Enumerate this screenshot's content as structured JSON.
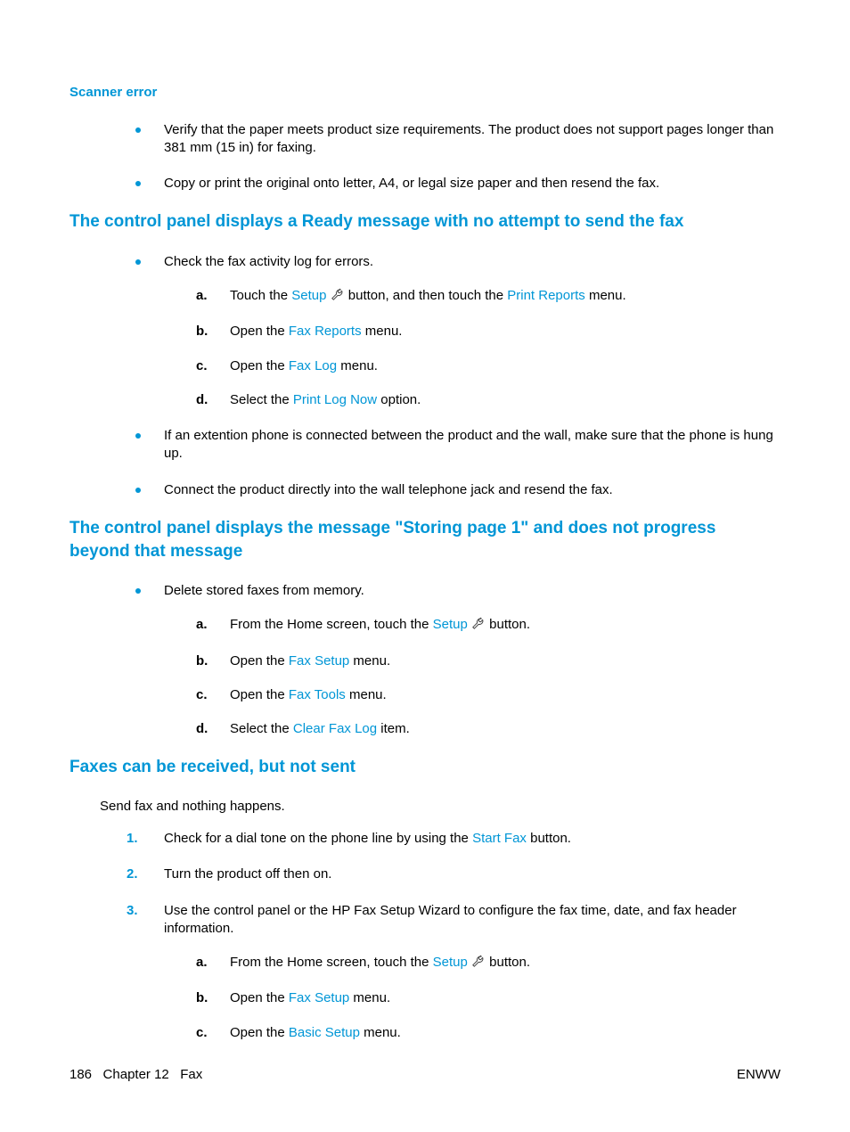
{
  "section_scanner_error": {
    "title": "Scanner error",
    "bullets": [
      "Verify that the paper meets product size requirements. The product does not support pages longer than 381 mm (15 in) for faxing.",
      "Copy or print the original onto letter, A4, or legal size paper and then resend the fax."
    ]
  },
  "section_ready": {
    "title": "The control panel displays a Ready message with no attempt to send the fax",
    "bullet1": "Check the fax activity log for errors.",
    "steps": {
      "a_pre": "Touch the ",
      "a_link1": "Setup",
      "a_mid": " button, and then touch the ",
      "a_link2": "Print Reports",
      "a_post": " menu.",
      "b_pre": "Open the ",
      "b_link": "Fax Reports",
      "b_post": " menu.",
      "c_pre": "Open the ",
      "c_link": "Fax Log",
      "c_post": " menu.",
      "d_pre": "Select the ",
      "d_link": "Print Log Now",
      "d_post": " option."
    },
    "bullet2": "If an extention phone is connected between the product and the wall, make sure that the phone is hung up.",
    "bullet3": "Connect the product directly into the wall telephone jack and resend the fax."
  },
  "section_storing": {
    "title": "The control panel displays the message \"Storing page 1\" and does not progress beyond that message",
    "bullet1": "Delete stored faxes from memory.",
    "steps": {
      "a_pre": "From the Home screen, touch the ",
      "a_link": "Setup",
      "a_post": " button.",
      "b_pre": "Open the ",
      "b_link": "Fax Setup",
      "b_post": " menu.",
      "c_pre": "Open the ",
      "c_link": "Fax Tools",
      "c_post": " menu.",
      "d_pre": "Select the ",
      "d_link": "Clear Fax Log",
      "d_post": " item."
    }
  },
  "section_faxes": {
    "title": "Faxes can be received, but not sent",
    "intro": "Send fax and nothing happens.",
    "num1_pre": "Check for a dial tone on the phone line by using the ",
    "num1_link": "Start Fax",
    "num1_post": " button.",
    "num2": "Turn the product off then on.",
    "num3": "Use the control panel or the HP Fax Setup Wizard to configure the fax time, date, and fax header information.",
    "steps": {
      "a_pre": "From the Home screen, touch the ",
      "a_link": "Setup",
      "a_post": " button.",
      "b_pre": "Open the ",
      "b_link": "Fax Setup",
      "b_post": " menu.",
      "c_pre": "Open the ",
      "c_link": "Basic Setup",
      "c_post": " menu."
    }
  },
  "footer": {
    "page": "186",
    "chapter": "Chapter 12   Fax",
    "right": "ENWW"
  }
}
